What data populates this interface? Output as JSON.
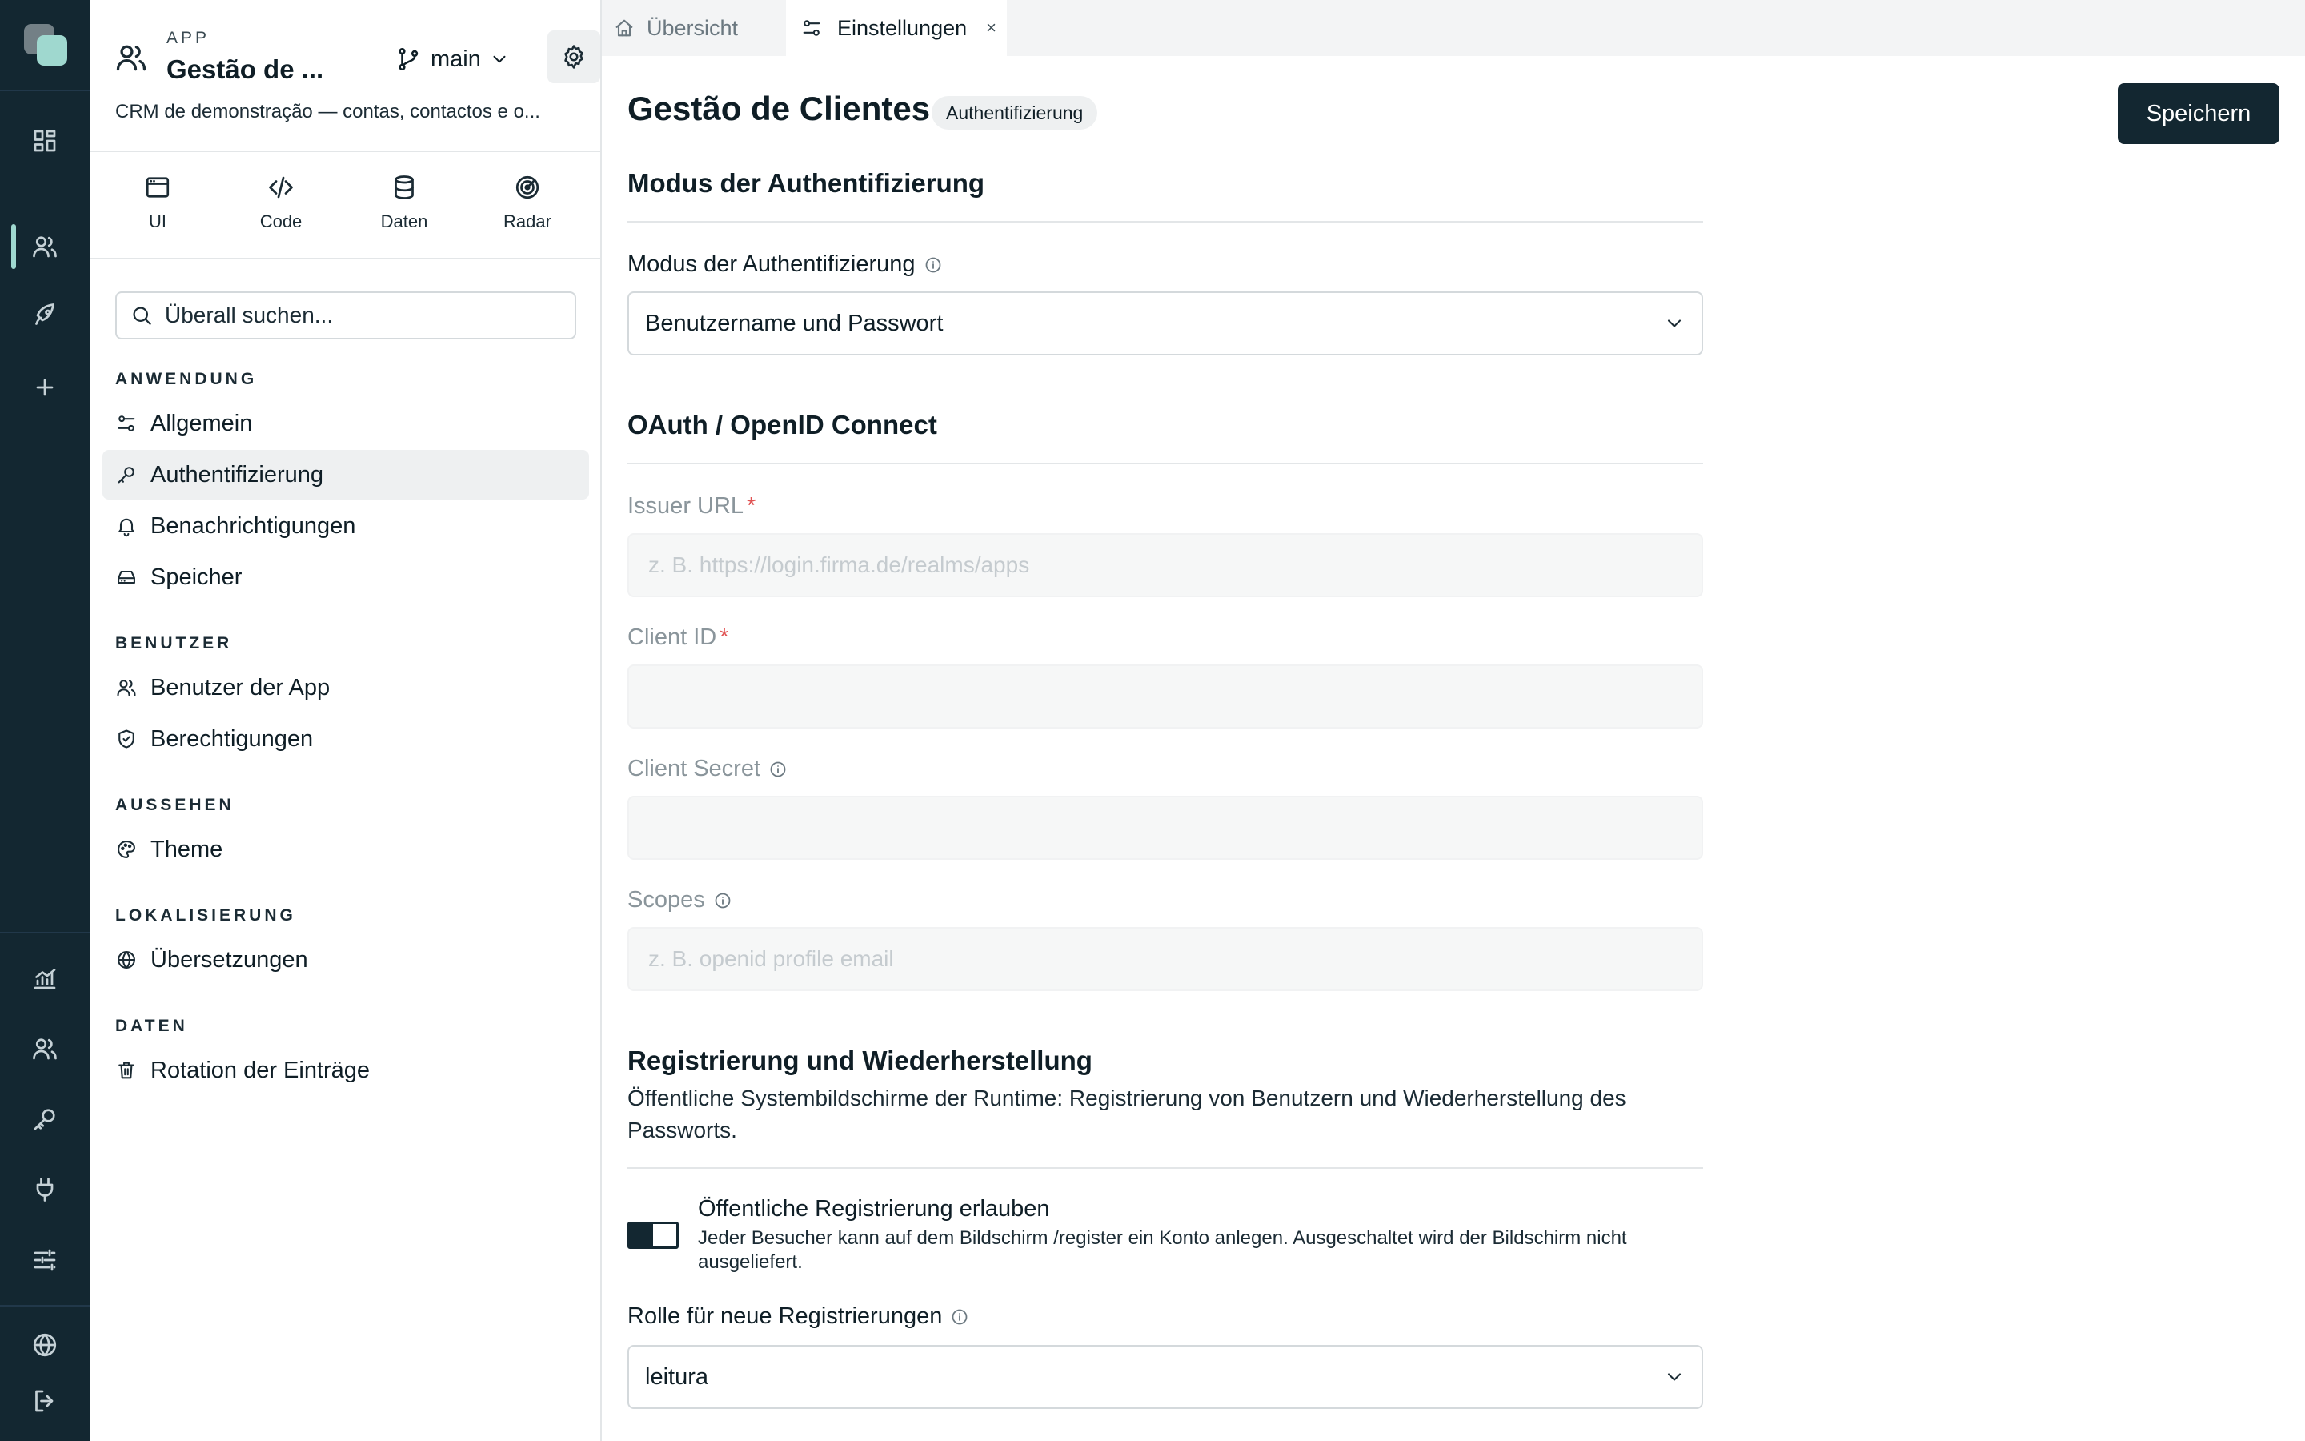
{
  "app": {
    "kicker": "APP",
    "name": "Gestão de ...",
    "branch": "main",
    "description": "CRM de demonstração — contas, contactos e o..."
  },
  "quick_actions": [
    {
      "label": "UI",
      "icon": "window-icon"
    },
    {
      "label": "Code",
      "icon": "code-icon"
    },
    {
      "label": "Daten",
      "icon": "database-icon"
    },
    {
      "label": "Radar",
      "icon": "radar-icon"
    }
  ],
  "search": {
    "placeholder": "Überall suchen..."
  },
  "nav": {
    "groups": [
      {
        "title": "ANWENDUNG",
        "items": [
          {
            "label": "Allgemein",
            "icon": "sliders-icon"
          },
          {
            "label": "Authentifizierung",
            "icon": "key-icon",
            "active": true
          },
          {
            "label": "Benachrichtigungen",
            "icon": "bell-icon"
          },
          {
            "label": "Speicher",
            "icon": "drive-icon"
          }
        ]
      },
      {
        "title": "BENUTZER",
        "items": [
          {
            "label": "Benutzer der App",
            "icon": "users-icon"
          },
          {
            "label": "Berechtigungen",
            "icon": "shield-icon"
          }
        ]
      },
      {
        "title": "AUSSEHEN",
        "items": [
          {
            "label": "Theme",
            "icon": "palette-icon"
          }
        ]
      },
      {
        "title": "LOKALISIERUNG",
        "items": [
          {
            "label": "Übersetzungen",
            "icon": "globe-icon"
          }
        ]
      },
      {
        "title": "DATEN",
        "items": [
          {
            "label": "Rotation der Einträge",
            "icon": "trash-icon"
          }
        ]
      }
    ]
  },
  "tabs": [
    {
      "label": "Übersicht",
      "icon": "home-icon"
    },
    {
      "label": "Einstellungen",
      "icon": "sliders-icon",
      "active": true,
      "close": "×"
    }
  ],
  "page": {
    "title": "Gestão de Clientes",
    "badge": "Authentifizierung",
    "save_label": "Speichern"
  },
  "auth_mode": {
    "section_title": "Modus der Authentifizierung",
    "field_label": "Modus der Authentifizierung",
    "value": "Benutzername und Passwort"
  },
  "oauth": {
    "section_title": "OAuth / OpenID Connect",
    "issuer_label": "Issuer URL",
    "issuer_placeholder": "z. B. https://login.firma.de/realms/apps",
    "client_id_label": "Client ID",
    "client_secret_label": "Client Secret",
    "scopes_label": "Scopes",
    "scopes_placeholder": "z. B. openid profile email",
    "required_mark": "*"
  },
  "registration": {
    "section_title": "Registrierung und Wiederherstellung",
    "description": "Öffentliche Systembildschirme der Runtime: Registrierung von Benutzern und Wiederherstellung des Passworts.",
    "toggle_title": "Öffentliche Registrierung erlauben",
    "toggle_desc": "Jeder Besucher kann auf dem Bildschirm /register ein Konto anlegen. Ausgeschaltet wird der Bildschirm nicht ausgeliefert.",
    "role_label": "Rolle für neue Registrierungen",
    "role_value": "leitura"
  },
  "colors": {
    "rail_bg": "#132731",
    "accent": "#9fd8cf",
    "primary_button": "#132731",
    "required": "#e05252"
  }
}
